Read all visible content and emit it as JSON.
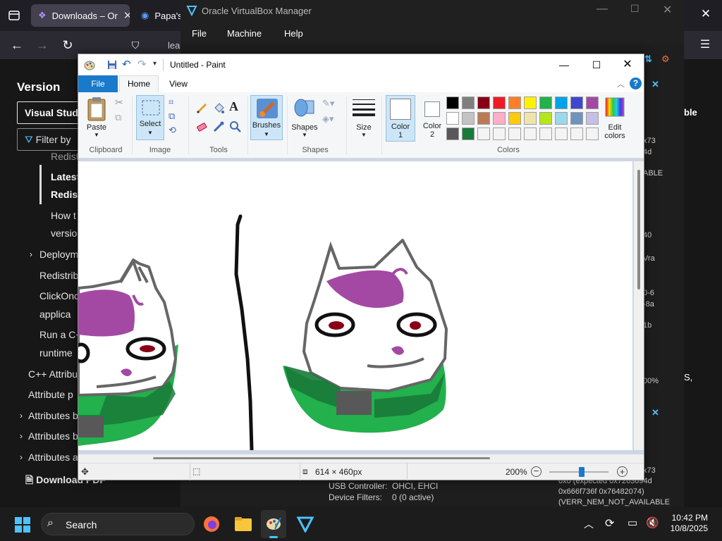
{
  "browser": {
    "tabs": [
      {
        "label": "Downloads – Or"
      },
      {
        "label": "Papa's"
      }
    ],
    "address_fragment": "lea"
  },
  "docs": {
    "version_heading": "Version",
    "version_select": "Visual Studio",
    "filter_placeholder": "Filter by",
    "nav": {
      "redist_partial": "Redist",
      "latest_1": "Latest",
      "latest_2": "Redist",
      "howto_1": "How t",
      "howto_2": "versio",
      "deploy": "Deploym",
      "redistrib": "Redistrib",
      "clickonce_1": "ClickOnc",
      "clickonce_2": "applica",
      "runac_1": "Run a C+",
      "runac_2": "runtime",
      "cpp_attr": "C++ Attribu",
      "attr_pr": "Attribute p",
      "attr_b1": "Attributes b",
      "attr_b2": "Attributes b",
      "attr_a": "Attributes a",
      "download_pdf": "Download PDF"
    }
  },
  "vbox": {
    "title": "Oracle VirtualBox Manager",
    "menu": {
      "file": "File",
      "machine": "Machine",
      "help": "Help"
    },
    "usb_label": "USB Controller:",
    "usb_value": "OHCI, EHCI",
    "filters_label": "Device Filters:",
    "filters_value": "0 (0 active)",
    "error_lines": [
      "0x0 (expected 0x7263694d",
      "0x666f736f 0x76482074)",
      "(VERR_NEM_NOT_AVAILABLE"
    ],
    "side_texts": [
      "x73",
      "4d",
      "ABLE",
      "40",
      "Vra",
      "0-6",
      "-8a",
      "1b",
      "00%",
      "x73",
      "ble",
      "S,"
    ]
  },
  "paint": {
    "title": "Untitled - Paint",
    "tabs": {
      "file": "File",
      "home": "Home",
      "view": "View"
    },
    "ribbon": {
      "paste": "Paste",
      "select": "Select",
      "brushes": "Brushes",
      "shapes": "Shapes",
      "size": "Size",
      "color1_a": "Color",
      "color1_b": "1",
      "color2_a": "Color",
      "color2_b": "2",
      "edit_a": "Edit",
      "edit_b": "colors",
      "groups": {
        "clipboard": "Clipboard",
        "image": "Image",
        "tools": "Tools",
        "shapes": "Shapes",
        "colors": "Colors"
      }
    },
    "palette": [
      "#000000",
      "#7f7f7f",
      "#880015",
      "#ed1c24",
      "#ff7f27",
      "#fff200",
      "#22b14c",
      "#00a2e8",
      "#3f48cc",
      "#a349a4",
      "#ffffff",
      "#c3c3c3",
      "#b97a57",
      "#ffaec9",
      "#ffc90e",
      "#efe4b0",
      "#b5e61d",
      "#99d9ea",
      "#7092be",
      "#c8bfe7",
      "#585858",
      "#1a7a3a",
      "#f4f4f4",
      "#f4f4f4",
      "#f4f4f4",
      "#f4f4f4",
      "#f4f4f4",
      "#f4f4f4",
      "#f4f4f4",
      "#f4f4f4"
    ],
    "status": {
      "dimensions": "614 × 460px",
      "zoom": "200%"
    }
  },
  "taskbar": {
    "search": "Search",
    "time": "10:42 PM",
    "date": "10/8/2025"
  }
}
